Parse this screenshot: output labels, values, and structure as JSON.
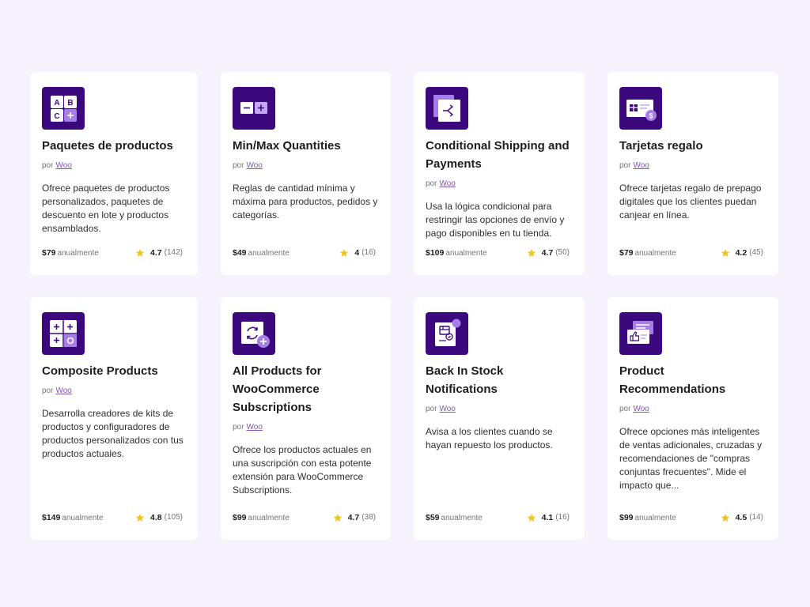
{
  "colors": {
    "page_background": "#f6f3fc",
    "card_background": "#ffffff",
    "icon_background": "#3c087e",
    "accent_purple": "#7f54b3",
    "star": "#f0c419"
  },
  "products": [
    {
      "title": "Paquetes de productos",
      "icon": "abc-bundle-icon",
      "vendor_prefix": "por",
      "vendor": "Woo",
      "description": "Ofrece paquetes de productos personalizados, paquetes de descuento en lote y productos ensamblados.",
      "price": "$79",
      "period": "anualmente",
      "rating": "4.7",
      "reviews": "(142)"
    },
    {
      "title": "Min/Max Quantities",
      "icon": "min-max-icon",
      "vendor_prefix": "por",
      "vendor": "Woo",
      "description": "Reglas de cantidad mínima y máxima para productos, pedidos y categorías.",
      "price": "$49",
      "period": "anualmente",
      "rating": "4",
      "reviews": "(16)"
    },
    {
      "title": "Conditional Shipping and Payments",
      "icon": "conditional-shipping-icon",
      "vendor_prefix": "por",
      "vendor": "Woo",
      "description": "Usa la lógica condicional para restringir las opciones de envío y pago disponibles en tu tienda.",
      "price": "$109",
      "period": "anualmente",
      "rating": "4.7",
      "reviews": "(50)"
    },
    {
      "title": "Tarjetas regalo",
      "icon": "gift-card-icon",
      "vendor_prefix": "por",
      "vendor": "Woo",
      "description": "Ofrece tarjetas regalo de prepago digitales que los clientes puedan canjear en línea.",
      "price": "$79",
      "period": "anualmente",
      "rating": "4.2",
      "reviews": "(45)"
    },
    {
      "title": "Composite Products",
      "icon": "composite-products-icon",
      "vendor_prefix": "por",
      "vendor": "Woo",
      "description": "Desarrolla creadores de kits de productos y configuradores de productos personalizados con tus productos actuales.",
      "price": "$149",
      "period": "anualmente",
      "rating": "4.8",
      "reviews": "(105)"
    },
    {
      "title": "All Products for WooCommerce Subscriptions",
      "icon": "subscriptions-icon",
      "vendor_prefix": "por",
      "vendor": "Woo",
      "description": "Ofrece los productos actuales en una suscripción con esta potente extensión para WooCommerce Subscriptions.",
      "price": "$99",
      "period": "anualmente",
      "rating": "4.7",
      "reviews": "(38)"
    },
    {
      "title": "Back In Stock Notifications",
      "icon": "back-in-stock-icon",
      "vendor_prefix": "por",
      "vendor": "Woo",
      "description": "Avisa a los clientes cuando se hayan repuesto los productos.",
      "price": "$59",
      "period": "anualmente",
      "rating": "4.1",
      "reviews": "(16)"
    },
    {
      "title": "Product Recommendations",
      "icon": "product-recommendations-icon",
      "vendor_prefix": "por",
      "vendor": "Woo",
      "description": "Ofrece opciones más inteligentes de ventas adicionales, cruzadas y recomendaciones de \"compras conjuntas frecuentes\". Mide el impacto que...",
      "price": "$99",
      "period": "anualmente",
      "rating": "4.5",
      "reviews": "(14)"
    }
  ]
}
